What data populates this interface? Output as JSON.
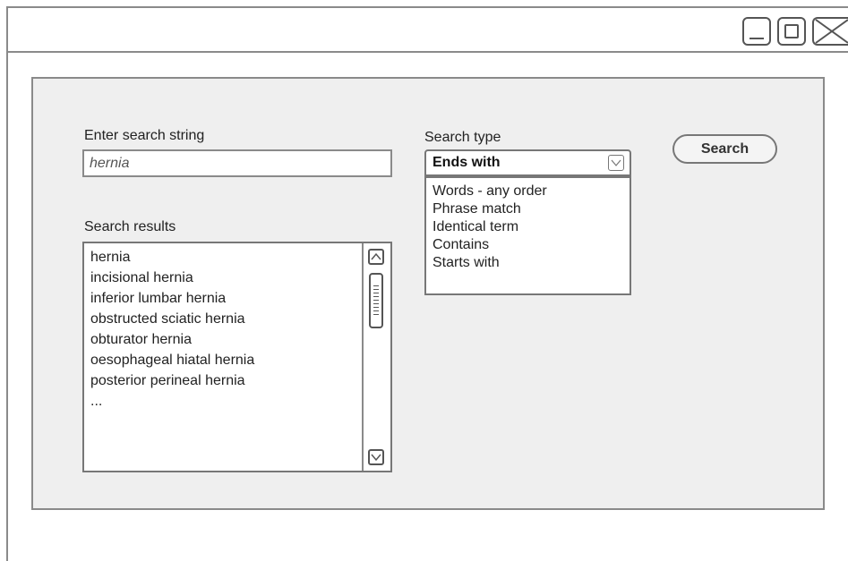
{
  "window": {
    "controls": [
      {
        "name": "minimize-icon"
      },
      {
        "name": "maximize-icon"
      },
      {
        "name": "close-icon"
      }
    ]
  },
  "search_string": {
    "label": "Enter search string",
    "value": "hernia"
  },
  "search_type": {
    "label": "Search type",
    "selected": "Ends with",
    "options": [
      "Words - any order",
      "Phrase match",
      "Identical term",
      "Contains",
      "Starts with"
    ]
  },
  "search_button": {
    "label": "Search"
  },
  "results": {
    "label": "Search results",
    "items": [
      "hernia",
      "incisional hernia",
      "inferior lumbar hernia",
      "obstructed sciatic hernia",
      "obturator hernia",
      "oesophageal hiatal hernia",
      "posterior perineal hernia",
      "..."
    ]
  },
  "colors": {
    "panel_bg": "#efefef",
    "border": "#8a8a8a",
    "text": "#222222"
  }
}
